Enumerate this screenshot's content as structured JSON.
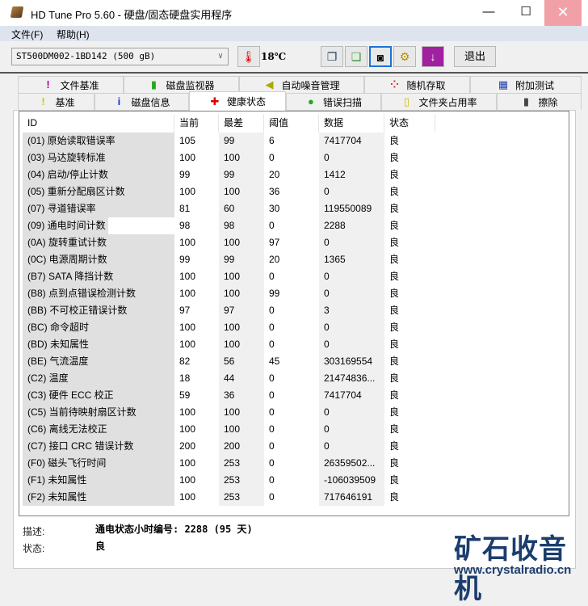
{
  "window": {
    "title": "HD Tune Pro 5.60 - 硬盘/固态硬盘实用程序",
    "min": "—",
    "max": "☐",
    "close": "✕"
  },
  "menu": [
    {
      "label": "文件(F)"
    },
    {
      "label": "帮助(H)"
    }
  ],
  "toolbar": {
    "drive": "ST500DM002-1BD142 (500 gB)",
    "temperature": "18℃",
    "exit_label": "退出"
  },
  "tabs_top": [
    {
      "label": "文件基准",
      "icon": "file-benchmark-icon",
      "glyph": "!"
    },
    {
      "label": "磁盘监视器",
      "icon": "disk-monitor-icon",
      "glyph": "▮"
    },
    {
      "label": "自动噪音管理",
      "icon": "speaker-icon",
      "glyph": "◀"
    },
    {
      "label": "随机存取",
      "icon": "random-access-icon",
      "glyph": "⁘"
    },
    {
      "label": "附加测试",
      "icon": "extra-tests-icon",
      "glyph": "▦"
    }
  ],
  "tabs_bottom": [
    {
      "label": "基准",
      "icon": "exclamation-icon",
      "glyph": "!"
    },
    {
      "label": "磁盘信息",
      "icon": "info-icon",
      "glyph": "i"
    },
    {
      "label": "健康状态",
      "icon": "red-cross-icon",
      "glyph": "✚",
      "active": true
    },
    {
      "label": "错误扫描",
      "icon": "magnifier-icon",
      "glyph": "●"
    },
    {
      "label": "文件夹占用率",
      "icon": "folder-icon",
      "glyph": "▯"
    },
    {
      "label": "擦除",
      "icon": "trash-icon",
      "glyph": "▮"
    }
  ],
  "table": {
    "headers": [
      "ID",
      "当前",
      "最差",
      "阈值",
      "数据",
      "状态"
    ],
    "rows": [
      [
        "(01) 原始读取错误率",
        "105",
        "99",
        "6",
        "7417704",
        "良"
      ],
      [
        "(03) 马达旋转标准",
        "100",
        "100",
        "0",
        "0",
        "良"
      ],
      [
        "(04) 启动/停止计数",
        "99",
        "99",
        "20",
        "1412",
        "良"
      ],
      [
        "(05) 重新分配扇区计数",
        "100",
        "100",
        "36",
        "0",
        "良"
      ],
      [
        "(07) 寻道错误率",
        "81",
        "60",
        "30",
        "119550089",
        "良"
      ],
      [
        "(09) 通电时间计数",
        "98",
        "98",
        "0",
        "2288",
        "良"
      ],
      [
        "(0A) 旋转重试计数",
        "100",
        "100",
        "97",
        "0",
        "良"
      ],
      [
        "(0C) 电源周期计数",
        "99",
        "99",
        "20",
        "1365",
        "良"
      ],
      [
        "(B7) SATA 降挡计数",
        "100",
        "100",
        "0",
        "0",
        "良"
      ],
      [
        "(B8) 点到点错误检测计数",
        "100",
        "100",
        "99",
        "0",
        "良"
      ],
      [
        "(BB) 不可校正错误计数",
        "97",
        "97",
        "0",
        "3",
        "良"
      ],
      [
        "(BC) 命令超时",
        "100",
        "100",
        "0",
        "0",
        "良"
      ],
      [
        "(BD) 未知属性",
        "100",
        "100",
        "0",
        "0",
        "良"
      ],
      [
        "(BE) 气流温度",
        "82",
        "56",
        "45",
        "303169554",
        "良"
      ],
      [
        "(C2) 温度",
        "18",
        "44",
        "0",
        "21474836...",
        "良"
      ],
      [
        "(C3) 硬件 ECC 校正",
        "59",
        "36",
        "0",
        "7417704",
        "良"
      ],
      [
        "(C5) 当前待映射扇区计数",
        "100",
        "100",
        "0",
        "0",
        "良"
      ],
      [
        "(C6) 离线无法校正",
        "100",
        "100",
        "0",
        "0",
        "良"
      ],
      [
        "(C7) 接口 CRC 错误计数",
        "200",
        "200",
        "0",
        "0",
        "良"
      ],
      [
        "(F0) 磁头飞行时间",
        "100",
        "253",
        "0",
        "26359502...",
        "良"
      ],
      [
        "(F1) 未知属性",
        "100",
        "253",
        "0",
        "-106039509",
        "良"
      ],
      [
        "(F2) 未知属性",
        "100",
        "253",
        "0",
        "717646191",
        "良"
      ]
    ],
    "selected_row": 5
  },
  "details": {
    "desc_label": "描述:",
    "desc_value": "通电状态小时编号: 2288 (95 天)",
    "status_label": "状态:",
    "status_value": "良"
  },
  "watermark": {
    "name": "矿石收音机",
    "url": "www.crystalradio.cn"
  }
}
